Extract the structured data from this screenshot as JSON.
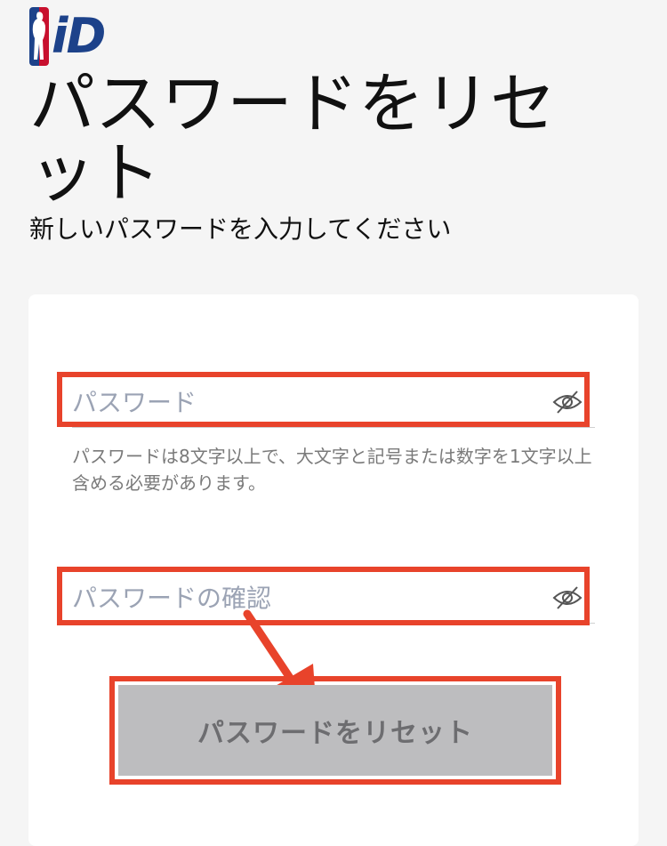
{
  "logo": {
    "text": "iD"
  },
  "header": {
    "title": "パスワードをリセット",
    "subtitle": "新しいパスワードを入力してください"
  },
  "form": {
    "password": {
      "placeholder": "パスワード",
      "value": ""
    },
    "password_hint": "パスワードは8文字以上で、大文字と記号または数字を1文字以上含める必要があります。",
    "confirm": {
      "placeholder": "パスワードの確認",
      "value": ""
    },
    "submit_label": "パスワードをリセット"
  },
  "annotation_color": "#e8432b",
  "icons": {
    "visibility_toggle": "eye-off-icon"
  }
}
